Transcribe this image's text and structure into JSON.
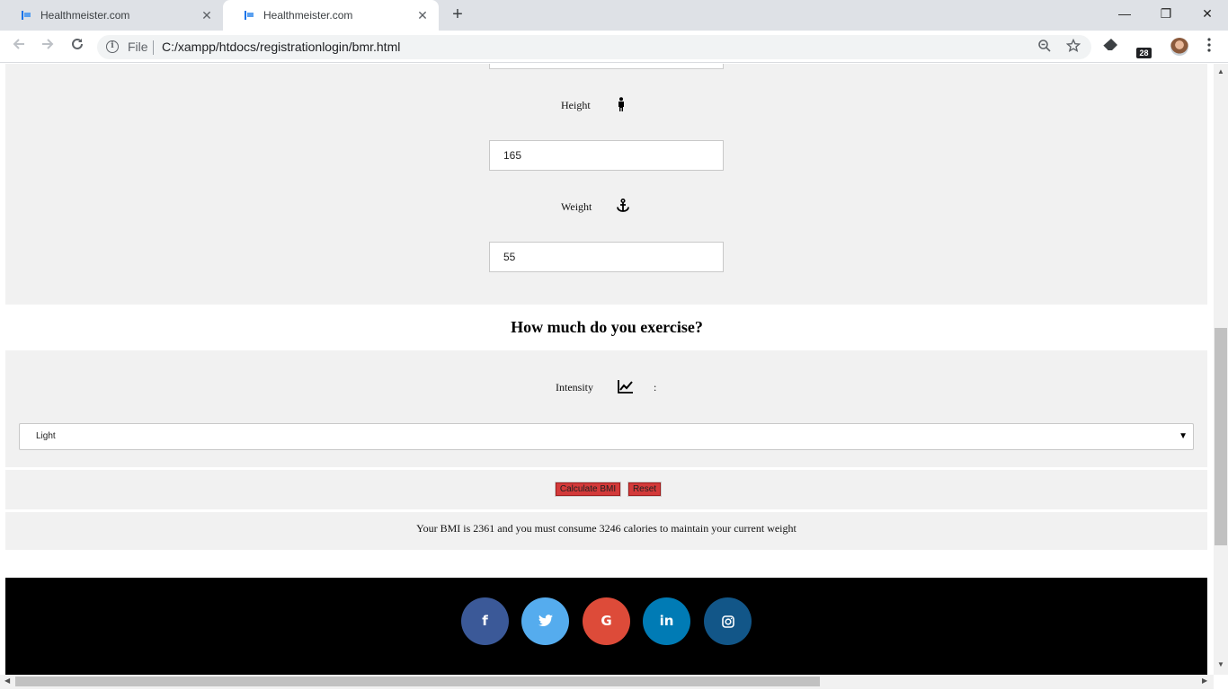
{
  "browser": {
    "tabs": [
      {
        "title": "Healthmeister.com",
        "active": false
      },
      {
        "title": "Healthmeister.com",
        "active": true
      }
    ],
    "new_tab_symbol": "+",
    "close_symbol": "✕",
    "window_controls": {
      "minimize": "—",
      "restore": "❐",
      "close": "✕"
    },
    "omnibox": {
      "info_symbol": "i",
      "scheme_label": "File",
      "url": "C:/xampp/htdocs/registrationlogin/bmr.html"
    },
    "extension_badge": "28",
    "icons": {
      "back": "back-arrow-icon",
      "forward": "forward-arrow-icon",
      "reload": "reload-icon",
      "zoom": "zoom-out-icon",
      "bookmark": "star-icon",
      "eraser": "eraser-extension-icon",
      "menu": "kebab-menu-icon"
    }
  },
  "form": {
    "height": {
      "label": "Height",
      "icon": "male-figure-icon",
      "value": "165"
    },
    "weight": {
      "label": "Weight",
      "icon": "anchor-icon",
      "value": "55"
    }
  },
  "exercise": {
    "heading": "How much do you exercise?",
    "intensity_label": "Intensity",
    "intensity_icon": "trending-up-chart-icon",
    "colon": ":",
    "selected": "Light"
  },
  "buttons": {
    "calculate": "Calculate BMI",
    "reset": "Reset"
  },
  "result": {
    "text": "Your BMI is 2361 and you must consume 3246 calories to maintain your current weight"
  },
  "footer": {
    "social": [
      {
        "name": "facebook",
        "glyph": "f",
        "color": "#3b5998"
      },
      {
        "name": "twitter",
        "glyph": "🐦",
        "color": "#55acee"
      },
      {
        "name": "google",
        "glyph": "G",
        "color": "#dd4b39"
      },
      {
        "name": "linkedin",
        "glyph": "in",
        "color": "#007bb5"
      },
      {
        "name": "instagram",
        "glyph": "◎",
        "color": "#125688"
      }
    ]
  }
}
